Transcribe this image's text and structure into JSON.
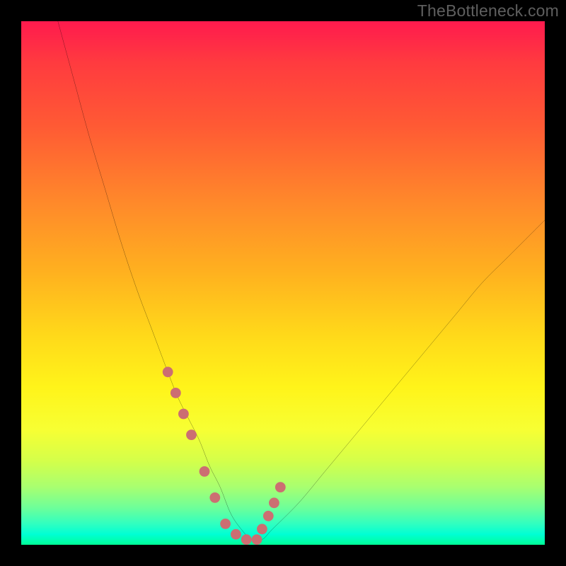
{
  "watermark": "TheBottleneck.com",
  "colors": {
    "background_frame": "#000000",
    "gradient_top": "#ff1a4e",
    "gradient_bottom": "#00ff97",
    "curve": "#000000",
    "marker": "#cc6e72",
    "watermark_text": "#5f5f5f"
  },
  "chart_data": {
    "type": "line",
    "title": "",
    "xlabel": "",
    "ylabel": "",
    "xlim": [
      0,
      100
    ],
    "ylim": [
      0,
      100
    ],
    "grid": false,
    "legend": false,
    "notes": "Background is a vertical rainbow gradient (red at top → green at bottom). Curve color is black; marker dots are muted salmon.",
    "series": [
      {
        "name": "bottleneck-curve",
        "x": [
          7,
          10,
          13,
          16,
          19,
          22,
          25,
          28,
          30,
          32,
          34,
          36,
          38,
          40,
          42,
          44,
          46,
          48,
          53,
          58,
          63,
          68,
          73,
          78,
          83,
          88,
          93,
          98,
          100
        ],
        "y": [
          100,
          89,
          78,
          68,
          58,
          49,
          41,
          33,
          28,
          24,
          20,
          15,
          11,
          6,
          3,
          1,
          1,
          3,
          8,
          14,
          20,
          26,
          32,
          38,
          44,
          50,
          55,
          60,
          62
        ]
      }
    ],
    "markers": {
      "name": "threshold-dots",
      "x": [
        28,
        29.5,
        31,
        32.5,
        35,
        37,
        39,
        41,
        43,
        45,
        46,
        47.2,
        48.3,
        49.5
      ],
      "y": [
        33,
        29,
        25,
        21,
        14,
        9,
        4,
        2,
        1,
        1,
        3,
        5.5,
        8,
        11
      ]
    }
  }
}
